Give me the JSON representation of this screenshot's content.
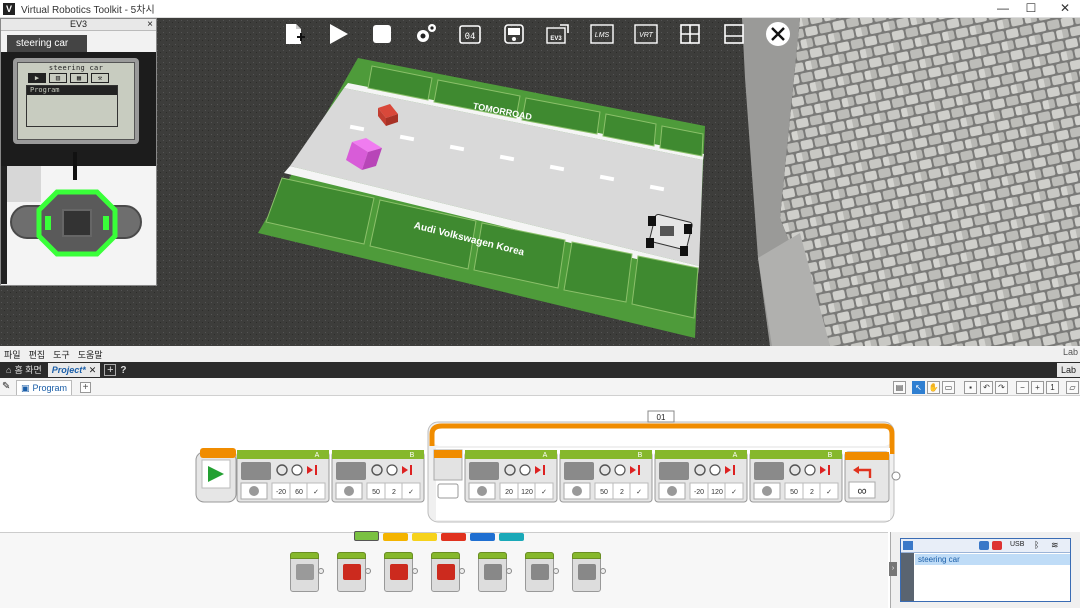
{
  "window": {
    "app_icon": "V",
    "title": "Virtual Robotics Toolkit - 5차시",
    "minimize": "—",
    "maximize": "☐",
    "close": "✕"
  },
  "toolbar": {
    "icons": [
      "new-project-icon",
      "play-icon",
      "stop-icon",
      "settings-gears-icon",
      "o4-icon",
      "display-icon",
      "ev3-export-icon",
      "lms-icon",
      "vrt-icon",
      "split-layout-icon",
      "horizontal-layout-icon",
      "close-circle-icon"
    ],
    "o4_label": "04",
    "ev3_label": "EV3",
    "lms_label": "LMS",
    "vrt_label": "VRT"
  },
  "scene": {
    "mat_brand_top": "TOMORROAD",
    "mat_brand_bottom": "Audi Volkswagen Korea"
  },
  "ev3": {
    "header": "EV3",
    "close": "×",
    "tab_label": "steering car",
    "lcd_title": "steering car",
    "lcd_item": "Program",
    "lcd_icons": [
      "run-recent-icon",
      "file-nav-icon",
      "brick-apps-icon",
      "settings-icon"
    ]
  },
  "menu": {
    "items": [
      "파일",
      "편집",
      "도구",
      "도움말"
    ],
    "lab_logo": "Lab"
  },
  "tabs": {
    "home": "홈 화면",
    "project": "Project*",
    "close": "✕",
    "add": "+",
    "help": "?",
    "lab": "Lab"
  },
  "program_tab": {
    "label": "Program",
    "add": "+"
  },
  "program": {
    "loop_label": "01",
    "blocks": [
      {
        "port": "A",
        "mode": "rotations",
        "values": [
          "-20",
          "60",
          "✓"
        ]
      },
      {
        "port": "B",
        "mode": "degrees",
        "values": [
          "50",
          "2",
          "✓"
        ]
      },
      {
        "port": "A",
        "mode": "rotations",
        "values": [
          "20",
          "120",
          "✓"
        ]
      },
      {
        "port": "B",
        "mode": "degrees",
        "values": [
          "50",
          "2",
          "✓"
        ]
      },
      {
        "port": "A",
        "mode": "rotations",
        "values": [
          "-20",
          "120",
          "✓"
        ]
      },
      {
        "port": "B",
        "mode": "degrees",
        "values": [
          "50",
          "2",
          "✓"
        ]
      }
    ],
    "loop_end_symbol": "∞"
  },
  "palette": {
    "tab_colors": [
      "#7ac142",
      "#f4b400",
      "#f6d21b",
      "#e0321e",
      "#1f6fd1",
      "#1aa9b8"
    ],
    "blocks": [
      "medium-motor-icon",
      "large-motor-icon",
      "move-steering-icon",
      "move-tank-icon",
      "display-icon",
      "sound-icon",
      "brick-status-light-icon"
    ]
  },
  "hardware": {
    "usb": "USB",
    "brick_name": "steering car"
  }
}
